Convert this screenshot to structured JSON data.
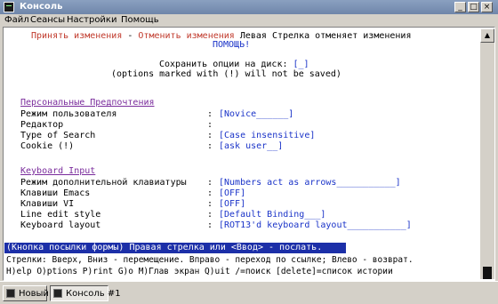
{
  "window": {
    "title": "Консоль"
  },
  "menu": [
    "Файл",
    "Сеансы",
    "Настройки",
    "Помощь"
  ],
  "terminal": {
    "accept_changes": "Принять изменения",
    "sep1": " - ",
    "cancel_changes": "Отменить изменения",
    "cancel_hint": " Левая Стрелка отменяет изменения",
    "help": "ПОМОЩЬ!",
    "save_options_label": "Сохранить опции на диск: ",
    "save_options_value": "[_]",
    "not_saved_note": "(options marked with (!) will not be saved)",
    "section_personal": "Персональные Предпочтения",
    "section_keyboard": "Keyboard Input",
    "rows": [
      {
        "label": "Режим пользователя",
        "value": "[Novice______]"
      },
      {
        "label": "Редактор",
        "value": ""
      },
      {
        "label": "Type of Search",
        "value": "[Case insensitive]"
      },
      {
        "label": "Cookie (!)",
        "value": "[ask user__]"
      },
      {
        "label": "Режим дополнительной клавиатуры",
        "value": "[Numbers act as arrows___________]"
      },
      {
        "label": "Клавиши Emacs",
        "value": "[OFF]"
      },
      {
        "label": "Клавиши VI",
        "value": "[OFF]"
      },
      {
        "label": "Line edit style",
        "value": "[Default Binding___]"
      },
      {
        "label": "Keyboard layout",
        "value": "[ROT13'd keyboard layout___________]"
      }
    ],
    "status": "(Кнопка посылки формы) Правая стрелка или <Ввод> - послать.",
    "help_line1": "Стрелки: Вверх, Вниз - перемещение. Вправо - переход по ссылке; Влево - возврат.",
    "help_line2": "H)elp O)ptions P)rint G)o M)Глав экран Q)uit /=поиск [delete]=список истории"
  },
  "taskbar": {
    "new_label": "Новый",
    "tab_label": "Консоль #1"
  }
}
